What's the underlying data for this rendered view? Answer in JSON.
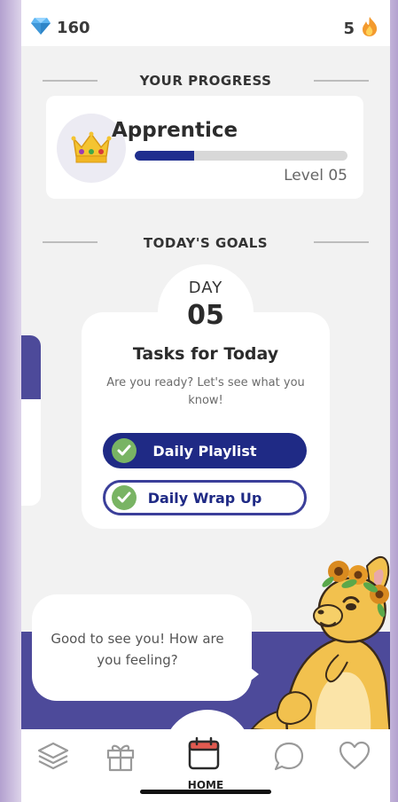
{
  "header": {
    "gems_count": "160",
    "streak_count": "5"
  },
  "progress": {
    "section_title": "YOUR PROGRESS",
    "rank": "Apprentice",
    "level_label": "Level 05",
    "progress_fraction": 0.28
  },
  "goals": {
    "section_title": "TODAY'S GOALS",
    "day_label": "DAY",
    "day_number": "05",
    "tasks_title": "Tasks for Today",
    "tasks_subtitle": "Are you ready? Let's see what you know!",
    "tasks": [
      {
        "label": "Daily Playlist",
        "done": true
      },
      {
        "label": "Daily Wrap Up",
        "done": true
      }
    ]
  },
  "mascot_message": "Good to see you! How are you feeling?",
  "nav": {
    "items": [
      {
        "icon": "layers-icon"
      },
      {
        "icon": "gift-icon"
      },
      {
        "icon": "calendar-icon",
        "label": "HOME"
      },
      {
        "icon": "chat-bubble-icon"
      },
      {
        "icon": "heart-icon"
      }
    ]
  },
  "colors": {
    "accent_navy": "#1f2a85",
    "band_purple": "#4d4a9a",
    "check_green": "#79b464",
    "calendar_red": "#e05a50"
  }
}
